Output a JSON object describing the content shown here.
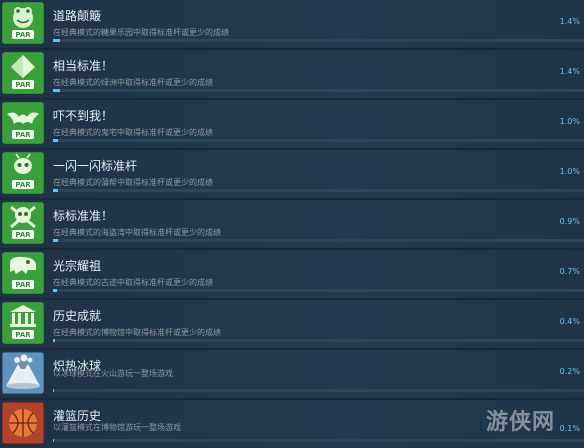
{
  "achievements": [
    {
      "title": "道路颠簸",
      "desc": "在经典模式的糖果乐园中取得标准杆或更少的成绩",
      "percent_text": "1.4%",
      "percent": 1.4,
      "icon": "frog-par-badge-icon",
      "icon_bg": "#3aa03c"
    },
    {
      "title": "相当标准！",
      "desc": "在经典模式的绿洲中取得标准杆或更少的成绩",
      "percent_text": "1.4%",
      "percent": 1.4,
      "icon": "gem-par-badge-icon",
      "icon_bg": "#3aa03c"
    },
    {
      "title": "吓不到我！",
      "desc": "在经典模式的鬼宅中取得标准杆或更少的成绩",
      "percent_text": "1.0%",
      "percent": 1.0,
      "icon": "bat-par-badge-icon",
      "icon_bg": "#3aa03c"
    },
    {
      "title": "一闪一闪标准杆",
      "desc": "在经典模式的蒲帮中取得标准杆或更少的成绩",
      "percent_text": "1.0%",
      "percent": 1.0,
      "icon": "alien-par-badge-icon",
      "icon_bg": "#3aa03c"
    },
    {
      "title": "标标准准！",
      "desc": "在经典模式的海盗湾中取得标准杆或更少的成绩",
      "percent_text": "0.9%",
      "percent": 0.9,
      "icon": "skull-par-badge-icon",
      "icon_bg": "#3aa03c"
    },
    {
      "title": "光宗耀祖",
      "desc": "在经典模式的古迹中取得标准杆或更少的成绩",
      "percent_text": "0.7%",
      "percent": 0.7,
      "icon": "dinosaur-par-badge-icon",
      "icon_bg": "#3aa03c"
    },
    {
      "title": "历史成就",
      "desc": "在经典模式的博物馆中取得标准杆或更少的成绩",
      "percent_text": "0.4%",
      "percent": 0.4,
      "icon": "museum-par-badge-icon",
      "icon_bg": "#3aa03c"
    },
    {
      "title": "炽热冰球",
      "desc": "以冰球模式在火山游玩一整场游戏",
      "percent_text": "0.2%",
      "percent": 0.2,
      "icon": "volcano-icon",
      "icon_bg": "#4b7fa6"
    },
    {
      "title": "灌篮历史",
      "desc": "以灌篮模式在博物馆游玩一整场游戏",
      "percent_text": "0.1%",
      "percent": 0.1,
      "icon": "basketball-icon",
      "icon_bg": "#c0392b"
    }
  ],
  "badge_text": "PAR",
  "watermark": "游侠网"
}
